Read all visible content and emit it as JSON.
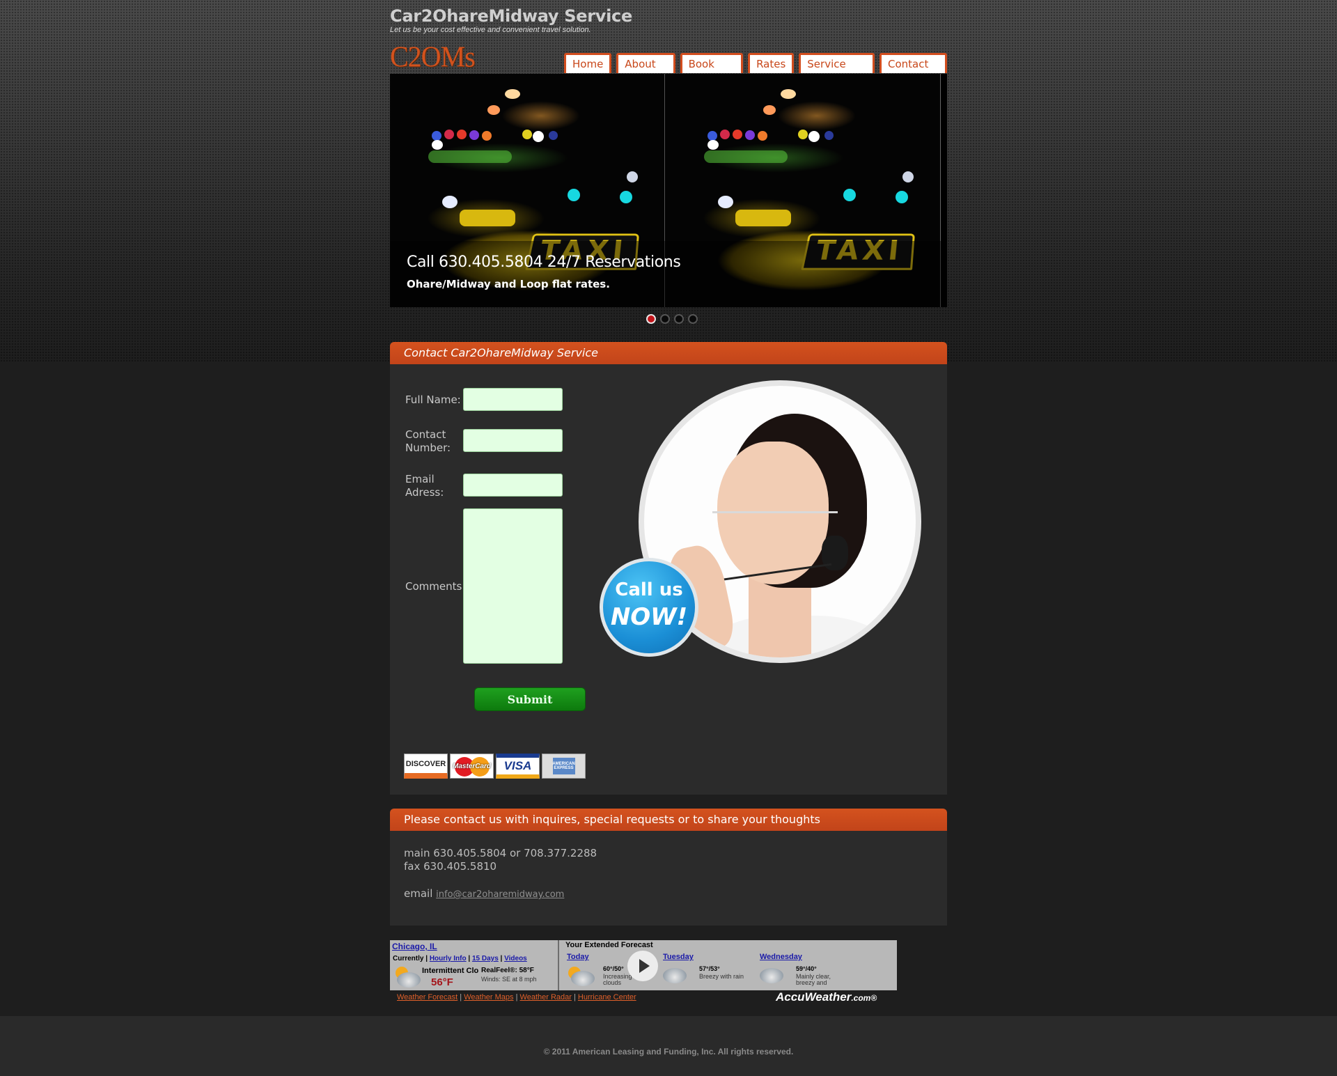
{
  "header": {
    "title": "Car2OhareMidway Service",
    "tagline": "Let us be your cost effective and convenient travel solution.",
    "logo": "C2OMs"
  },
  "nav": {
    "items": [
      {
        "label": "Home"
      },
      {
        "label": "About Us"
      },
      {
        "label": "Book Now"
      },
      {
        "label": "Rates"
      },
      {
        "label": "Service Area"
      },
      {
        "label": "Contact Us"
      }
    ]
  },
  "slider": {
    "headline": "Call 630.405.5804 24/7 Reservations",
    "subline": "Ohare/Midway and Loop flat rates.",
    "sign_text": "TAXI",
    "dot_count": 4,
    "active_dot": 1
  },
  "contact_form": {
    "heading": "Contact Car2OhareMidway Service",
    "full_name_label": "Full Name:",
    "contact_number_label": "Contact Number:",
    "email_label": "Email Adress:",
    "comments_label": "Comments:",
    "submit_label": "Submit",
    "full_name_value": "",
    "contact_number_value": "",
    "email_value": "",
    "comments_value": "",
    "call_badge_line1": "Call us",
    "call_badge_line2": "NOW!"
  },
  "payment_cards": {
    "discover": "DISCOVER",
    "mastercard": "MasterCard",
    "visa": "VISA",
    "amex": "AMERICAN EXPRESS"
  },
  "info": {
    "heading": "Please contact us with inquires, special requests or to share your thoughts",
    "main_phone": "main 630.405.5804 or 708.377.2288",
    "fax": "fax 630.405.5810",
    "email_label": "email",
    "email": "info@car2oharemidway.com"
  },
  "weather": {
    "city": "Chicago, IL",
    "currently_label": "Currently",
    "link_hourly": "Hourly Info",
    "link_15days": "15 Days",
    "link_videos": "Videos",
    "condition": "Intermittent Clo",
    "realfeel": "RealFeel®: 58°F",
    "winds": "Winds: SE at 8 mph",
    "temp": "56°F",
    "extended_label": "Your Extended Forecast",
    "days": [
      {
        "name": "Today",
        "hilo": "60°/50°",
        "desc": "Increasing clouds"
      },
      {
        "name": "Tuesday",
        "hilo": "57°/53°",
        "desc": "Breezy with rain"
      },
      {
        "name": "Wednesday",
        "hilo": "59°/40°",
        "desc": "Mainly clear, breezy and"
      }
    ],
    "footer_links": [
      "Weather Forecast",
      "Weather Maps",
      "Weather Radar",
      "Hurricane Center"
    ],
    "brand": "AccuWeather",
    "brand_suffix": ".com®"
  },
  "footer": {
    "copyright": "© 2011 American Leasing and Funding, Inc. All rights reserved."
  },
  "colors": {
    "accent": "#d2521d",
    "input_bg": "#e3ffe3",
    "submit_green": "#149014"
  }
}
